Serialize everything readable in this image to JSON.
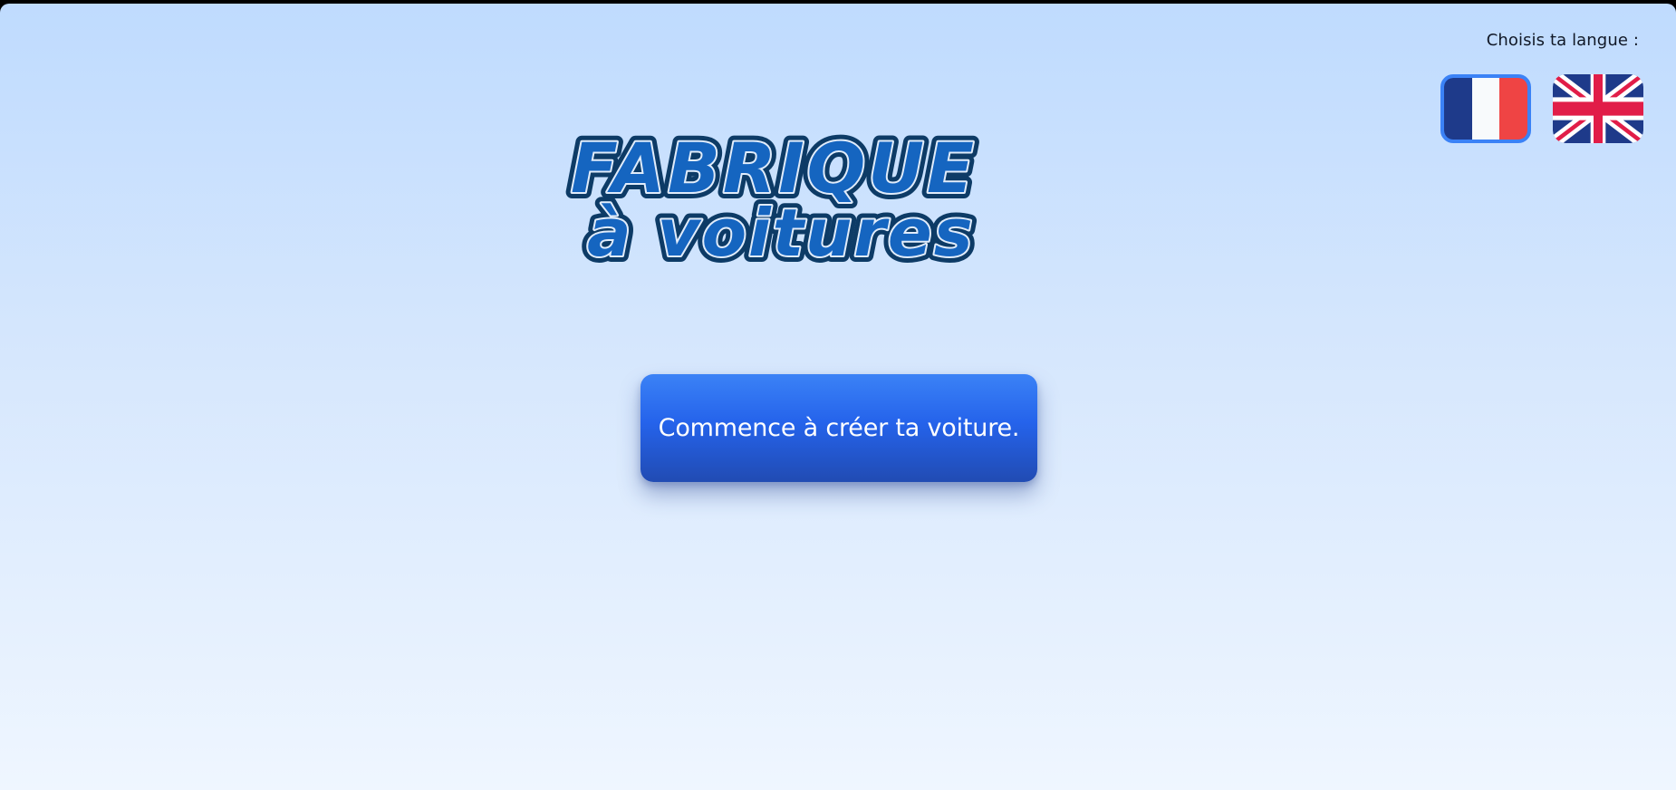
{
  "language_selector": {
    "label": "Choisis ta langue :",
    "options": [
      {
        "code": "fr",
        "icon": "french-flag-icon",
        "selected": true
      },
      {
        "code": "en",
        "icon": "uk-flag-icon",
        "selected": false
      }
    ]
  },
  "logo": {
    "line1": "FABRIQUE",
    "line2": "à voitures",
    "fill_color": "#1565c0",
    "outline_color": "#0d3b66"
  },
  "main": {
    "start_button_label": "Commence à créer ta voiture."
  },
  "colors": {
    "accent": "#3b82f6",
    "button_top": "#3b82f6",
    "button_bottom": "#1e40af",
    "background_top": "#bfdbfe",
    "background_bottom": "#eff6ff"
  }
}
